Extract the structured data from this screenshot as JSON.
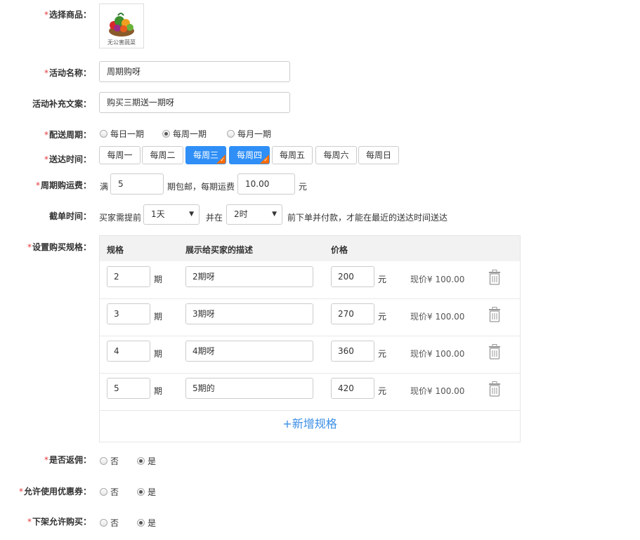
{
  "form": {
    "product": {
      "label": "选择商品：",
      "caption": "无公害蔬菜"
    },
    "activity_name": {
      "label": "活动名称：",
      "value": "周期购呀"
    },
    "activity_desc": {
      "label": "活动补充文案：",
      "value": "购买三期送一期呀"
    },
    "delivery_cycle": {
      "label": "配送周期：",
      "options": [
        "每日一期",
        "每周一期",
        "每月一期"
      ],
      "selected": "每周一期"
    },
    "delivery_time": {
      "label": "送达时间：",
      "days": [
        "每周一",
        "每周二",
        "每周三",
        "每周四",
        "每周五",
        "每周六",
        "每周日"
      ],
      "selected": [
        "每周三",
        "每周四"
      ]
    },
    "shipping_fee": {
      "label": "周期购运费：",
      "prefix": "满",
      "threshold": "5",
      "middle": "期包邮，每期运费",
      "fee": "10.00",
      "suffix": "元"
    },
    "cutoff": {
      "label": "截单时间：",
      "prefix": "买家需提前",
      "days_value": "1天",
      "middle": "并在",
      "hour_value": "2时",
      "suffix": "前下单并付款，才能在最近的送达时间送达"
    },
    "specs": {
      "label": "设置购买规格：",
      "headers": {
        "spec": "规格",
        "desc": "展示给买家的描述",
        "price": "价格"
      },
      "unit_period": "期",
      "unit_yuan": "元",
      "rows": [
        {
          "periods": "2",
          "desc": "2期呀",
          "price": "200",
          "current": "现价¥ 100.00"
        },
        {
          "periods": "3",
          "desc": "3期呀",
          "price": "270",
          "current": "现价¥ 100.00"
        },
        {
          "periods": "4",
          "desc": "4期呀",
          "price": "360",
          "current": "现价¥ 100.00"
        },
        {
          "periods": "5",
          "desc": "5期的",
          "price": "420",
          "current": "现价¥ 100.00"
        }
      ],
      "add_label": "+新增规格"
    },
    "commission": {
      "label": "是否返佣：",
      "no": "否",
      "yes": "是",
      "selected": "是"
    },
    "coupon": {
      "label": "允许使用优惠券：",
      "no": "否",
      "yes": "是",
      "selected": "是"
    },
    "offshelf": {
      "label": "下架允许购买：",
      "no": "否",
      "yes": "是",
      "selected": "是"
    }
  },
  "colors": {
    "accent": "#2f8ff7",
    "required": "#e4393c",
    "tag": "#ff6d00",
    "link": "#3a8ee6"
  }
}
